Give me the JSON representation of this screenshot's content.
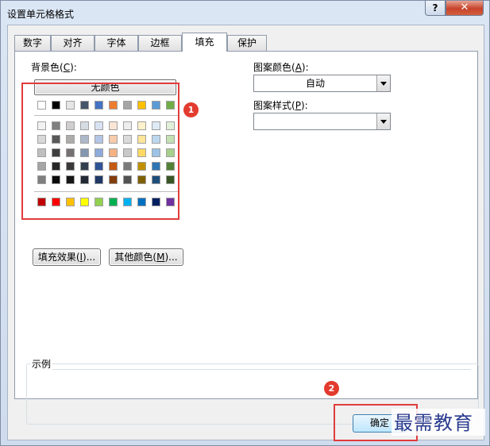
{
  "window": {
    "title": "设置单元格格式",
    "help_label": "?",
    "close_label": "✕"
  },
  "tabs": [
    {
      "label": "数字"
    },
    {
      "label": "对齐"
    },
    {
      "label": "字体"
    },
    {
      "label": "边框"
    },
    {
      "label": "填充"
    },
    {
      "label": "保护"
    }
  ],
  "active_tab": "填充",
  "fill": {
    "background_label": "背景色(",
    "background_key": "C",
    "background_close": "):",
    "no_color_label": "无颜色",
    "fill_effects_label": "填充效果(",
    "fill_effects_key": "I",
    "fill_effects_close": ")...",
    "more_colors_label": "其他颜色(",
    "more_colors_key": "M",
    "more_colors_close": ")..."
  },
  "pattern": {
    "color_label": "图案颜色(",
    "color_key": "A",
    "color_close": "):",
    "color_value": "自动",
    "style_label": "图案样式(",
    "style_key": "P",
    "style_close": "):",
    "style_value": ""
  },
  "sample_label": "示例",
  "buttons": {
    "ok_label": "确定"
  },
  "annotations": {
    "badge1": "1",
    "badge2": "2"
  },
  "watermark": "最需教育",
  "palette": {
    "theme_row": [
      "#ffffff",
      "#000000",
      "#e7e6e6",
      "#44546a",
      "#4472c4",
      "#ed7d31",
      "#a5a5a5",
      "#ffc000",
      "#5b9bd5",
      "#70ad47"
    ],
    "tints": [
      [
        "#f2f2f2",
        "#7f7f7f",
        "#d0cece",
        "#d6dce4",
        "#d9e2f3",
        "#fbe5d5",
        "#ededed",
        "#fff2cc",
        "#deebf6",
        "#e2efd9"
      ],
      [
        "#d8d8d8",
        "#595959",
        "#aeabab",
        "#adb9ca",
        "#b4c6e7",
        "#f7cbac",
        "#dbdbdb",
        "#fee599",
        "#bdd7ee",
        "#c5e0b3"
      ],
      [
        "#bfbfbf",
        "#3f3f3f",
        "#757070",
        "#8496b0",
        "#8eaadb",
        "#f4b183",
        "#c9c9c9",
        "#ffd965",
        "#9cc3e5",
        "#a8d08d"
      ],
      [
        "#a5a5a5",
        "#262626",
        "#3a3838",
        "#323f4f",
        "#2f5496",
        "#c55a11",
        "#7b7b7b",
        "#bf9000",
        "#2e75b5",
        "#538135"
      ],
      [
        "#7f7f7f",
        "#0c0c0c",
        "#171616",
        "#222a35",
        "#1f3864",
        "#833c0b",
        "#525252",
        "#7f6000",
        "#1e4e79",
        "#375623"
      ]
    ],
    "standard_row": [
      "#c00000",
      "#ff0000",
      "#ffc000",
      "#ffff00",
      "#92d050",
      "#00b050",
      "#00b0f0",
      "#0070c0",
      "#002060",
      "#7030a0"
    ]
  }
}
